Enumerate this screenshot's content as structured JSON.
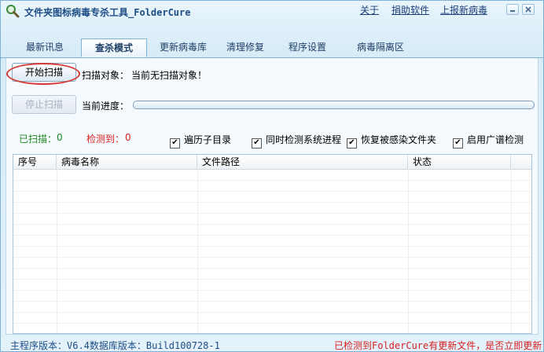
{
  "app": {
    "title": "文件夹图标病毒专杀工具_FolderCure"
  },
  "top_links": [
    "关于",
    "捐助软件",
    "上报新病毒"
  ],
  "tabs": [
    "最新讯息",
    "查杀模式",
    "更新病毒库",
    "清理修复",
    "程序设置",
    "病毒隔离区"
  ],
  "active_tab": 1,
  "scan": {
    "start_button": "开始扫描",
    "stop_button": "停止扫描",
    "target_label": "扫描对象：",
    "target_value": "当前无扫描对象！",
    "progress_label": "当前进度：",
    "progress": 0
  },
  "stats": {
    "scanned_label": "已扫描：",
    "scanned_value": "0",
    "detected_label": "检测到：",
    "detected_value": "0"
  },
  "options": [
    {
      "label": "遍历子目录",
      "checked": true
    },
    {
      "label": "同时检测系统进程",
      "checked": true
    },
    {
      "label": "恢复被感染文件夹",
      "checked": true
    },
    {
      "label": "启用广谱检测",
      "checked": true
    }
  ],
  "table": {
    "columns": [
      "序号",
      "病毒名称",
      "文件路径",
      "状态"
    ]
  },
  "status": {
    "version_text": "主程序版本：V6.4数据库版本：Build100728-1",
    "update_notice": "已检测到FolderCure有更新文件，是否立即更新"
  },
  "colors": {
    "accent": "#1e4d86",
    "scanned": "#1f8a1f",
    "detected": "#d8201f",
    "ring": "#d53a35"
  },
  "icons": [
    "magnifier-icon",
    "minimize-icon",
    "close-icon",
    "checkmark-icon"
  ]
}
